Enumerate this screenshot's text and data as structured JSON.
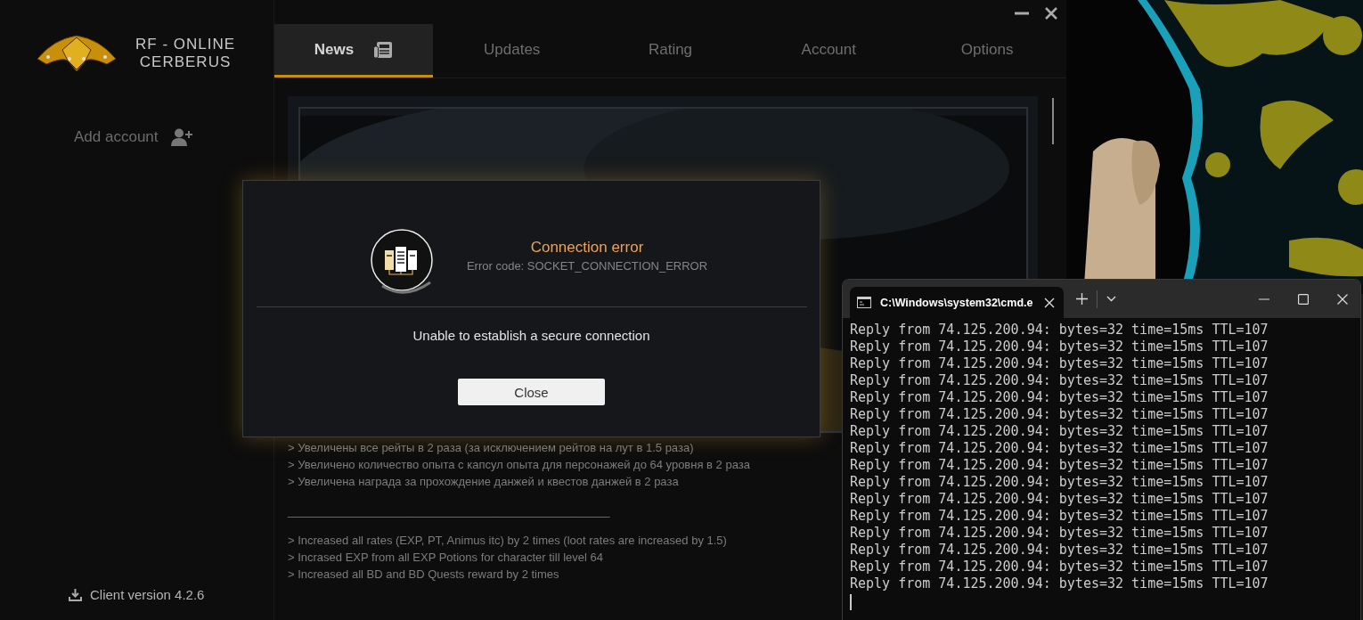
{
  "launcher": {
    "logo": {
      "line_1": "RF - ONLINE",
      "line_2": "CERBERUS"
    },
    "add_account": "Add account",
    "client_version": "Client version 4.2.6",
    "tabs": [
      {
        "label": "News",
        "selected": true
      },
      {
        "label": "Updates",
        "selected": false
      },
      {
        "label": "Rating",
        "selected": false
      },
      {
        "label": "Account",
        "selected": false
      },
      {
        "label": "Options",
        "selected": false
      }
    ],
    "news": {
      "lines_ru": [
        "> Увеличены все рейты в 2 раза (за исключением рейтов на лут в 1.5 раза)",
        "> Увеличено количество опыта с капсул опыта для персонажей до 64 уровня в 2 раза",
        "> Увеличена награда за прохождение данжей и квестов данжей в 2 раза"
      ],
      "separator": "__________________________________________________",
      "lines_en": [
        "> Increased all rates (EXP, PT, Animus itc) by 2 times (loot rates are increased by 1.5)",
        "> Incrased EXP from all EXP Potions for character till level 64",
        "> Increased all BD and BD Quests reward by 2 times"
      ]
    }
  },
  "dialog": {
    "title": "Connection error",
    "error_code": "Error code: SOCKET_CONNECTION_ERROR",
    "message": "Unable to establish a secure connection",
    "button": "Close"
  },
  "terminal": {
    "tab_title": "C:\\Windows\\system32\\cmd.e",
    "lines": [
      "Reply from 74.125.200.94: bytes=32 time=15ms TTL=107",
      "Reply from 74.125.200.94: bytes=32 time=15ms TTL=107",
      "Reply from 74.125.200.94: bytes=32 time=15ms TTL=107",
      "Reply from 74.125.200.94: bytes=32 time=15ms TTL=107",
      "Reply from 74.125.200.94: bytes=32 time=15ms TTL=107",
      "Reply from 74.125.200.94: bytes=32 time=15ms TTL=107",
      "Reply from 74.125.200.94: bytes=32 time=15ms TTL=107",
      "Reply from 74.125.200.94: bytes=32 time=15ms TTL=107",
      "Reply from 74.125.200.94: bytes=32 time=15ms TTL=107",
      "Reply from 74.125.200.94: bytes=32 time=15ms TTL=107",
      "Reply from 74.125.200.94: bytes=32 time=15ms TTL=107",
      "Reply from 74.125.200.94: bytes=32 time=15ms TTL=107",
      "Reply from 74.125.200.94: bytes=32 time=15ms TTL=107",
      "Reply from 74.125.200.94: bytes=32 time=15ms TTL=107",
      "Reply from 74.125.200.94: bytes=32 time=15ms TTL=107",
      "Reply from 74.125.200.94: bytes=32 time=15ms TTL=107"
    ]
  }
}
